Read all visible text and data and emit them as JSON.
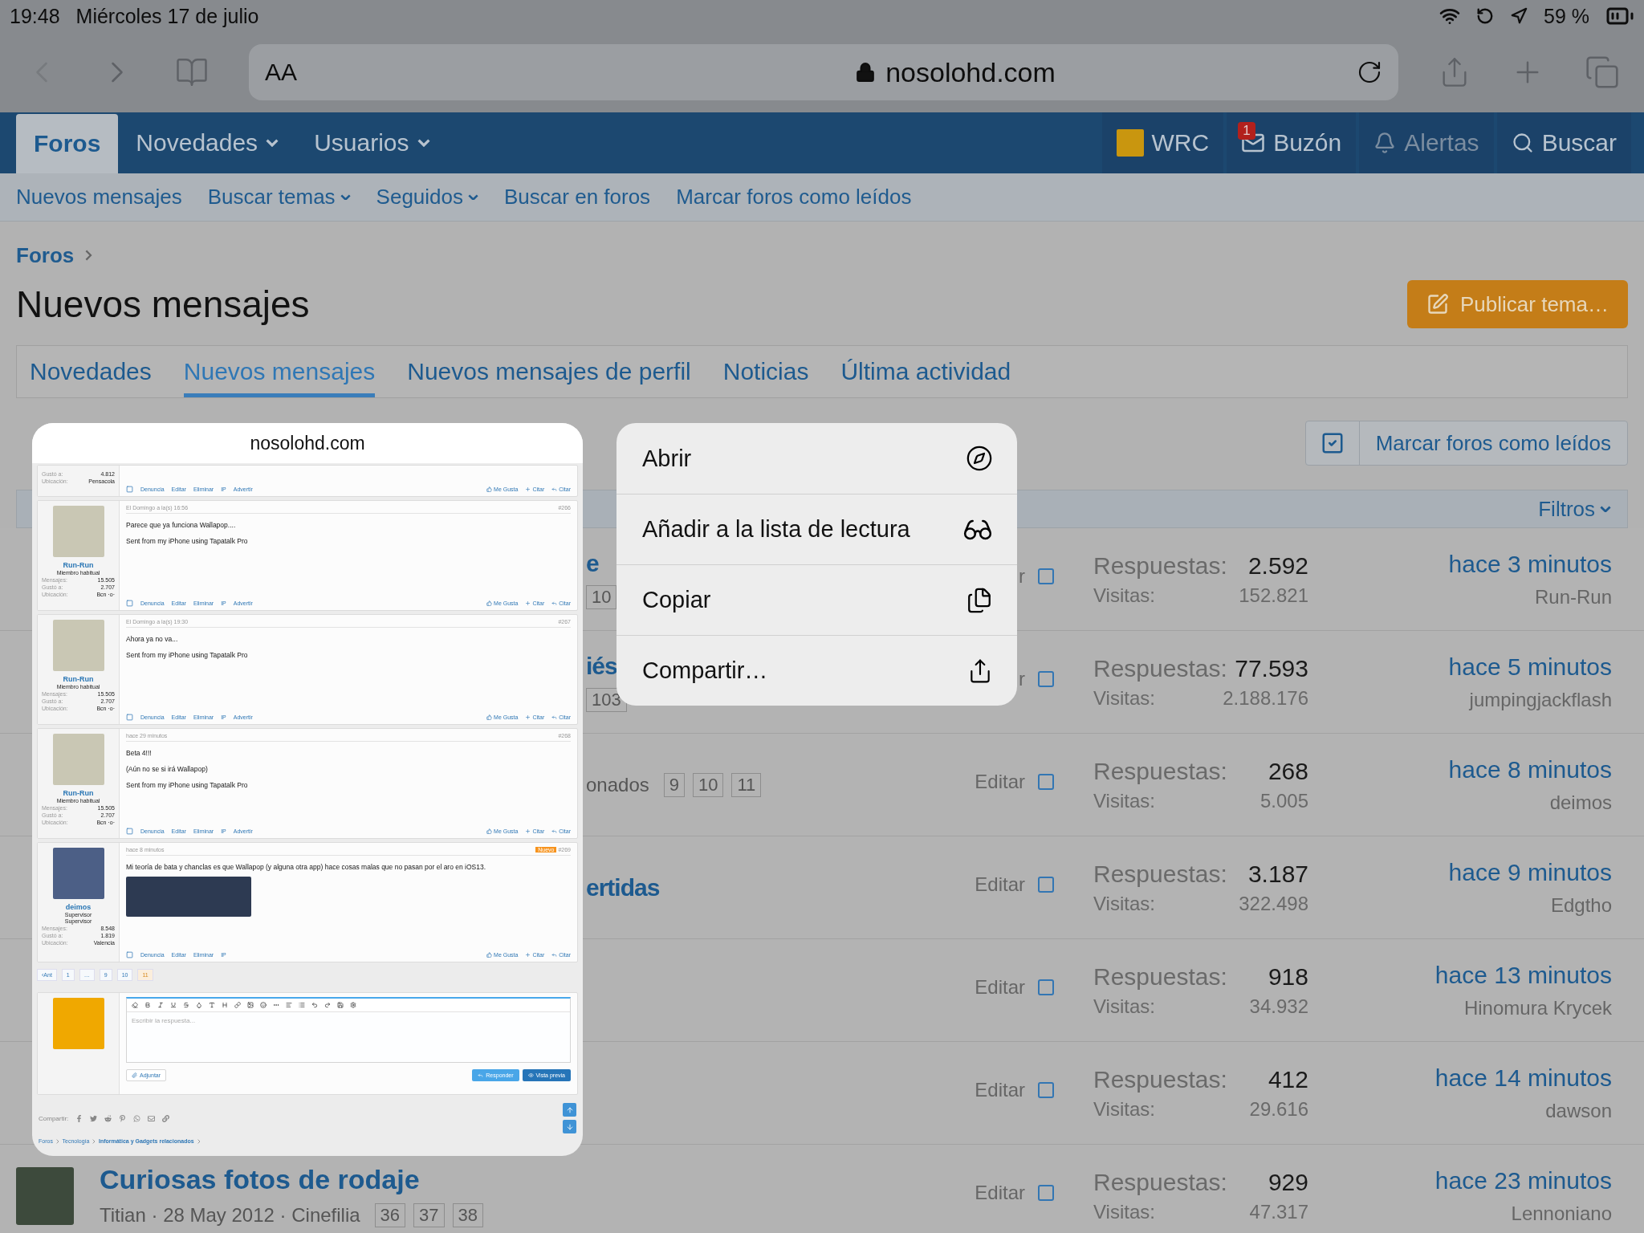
{
  "status_bar": {
    "time": "19:48",
    "date": "Miércoles 17 de julio",
    "battery": "59 %"
  },
  "browser": {
    "text_size": "AA",
    "address": "nosolohd.com"
  },
  "nav": {
    "tabs": [
      {
        "label": "Foros",
        "selected": true,
        "dropdown": false
      },
      {
        "label": "Novedades",
        "selected": false,
        "dropdown": true
      },
      {
        "label": "Usuarios",
        "selected": false,
        "dropdown": true
      }
    ],
    "right": [
      {
        "kind": "avatar",
        "label": "WRC"
      },
      {
        "kind": "mail",
        "label": "Buzón",
        "badge": "1"
      },
      {
        "kind": "bell",
        "label": "Alertas"
      },
      {
        "kind": "search",
        "label": "Buscar"
      }
    ]
  },
  "sub_nav": [
    {
      "label": "Nuevos mensajes",
      "dropdown": false
    },
    {
      "label": "Buscar temas",
      "dropdown": true
    },
    {
      "label": "Seguidos",
      "dropdown": true
    },
    {
      "label": "Buscar en foros",
      "dropdown": false
    },
    {
      "label": "Marcar foros como leídos",
      "dropdown": false
    }
  ],
  "breadcrumb": [
    "Foros"
  ],
  "page_title": "Nuevos mensajes",
  "post_button": "Publicar tema…",
  "tabs": [
    {
      "label": "Novedades",
      "selected": false
    },
    {
      "label": "Nuevos mensajes",
      "selected": true
    },
    {
      "label": "Nuevos mensajes de perfil",
      "selected": false
    },
    {
      "label": "Noticias",
      "selected": false
    },
    {
      "label": "Última actividad",
      "selected": false
    }
  ],
  "mark_read_button": "Marcar foros como leídos",
  "filters": "Filtros",
  "threads": [
    {
      "kind": "partial",
      "title_fragment": "e",
      "pages": [
        "10"
      ],
      "edit": "r",
      "checked": false,
      "replies_label": "Respuestas:",
      "replies": "2.592",
      "views_label": "Visitas:",
      "views": "152.821",
      "time": "hace 3 minutos",
      "user": "Run-Run"
    },
    {
      "kind": "partial",
      "title_fragment": "iés",
      "pages": [
        "103"
      ],
      "edit": "r",
      "checked": false,
      "replies_label": "Respuestas:",
      "replies": "77.593",
      "views_label": "Visitas:",
      "views": "2.188.176",
      "time": "hace 5 minutos",
      "user": "jumpingjackflash"
    },
    {
      "kind": "partial",
      "meta_fragment": "onados",
      "pages": [
        "9",
        "10",
        "11"
      ],
      "edit": "Editar",
      "checked": false,
      "replies_label": "Respuestas:",
      "replies": "268",
      "views_label": "Visitas:",
      "views": "5.005",
      "time": "hace 8 minutos",
      "user": "deimos"
    },
    {
      "kind": "partial",
      "title_fragment": "ertidas",
      "edit": "Editar",
      "checked": false,
      "replies_label": "Respuestas:",
      "replies": "3.187",
      "views_label": "Visitas:",
      "views": "322.498",
      "time": "hace 9 minutos",
      "user": "Edgtho"
    },
    {
      "kind": "partial",
      "edit": "Editar",
      "checked": false,
      "replies_label": "Respuestas:",
      "replies": "918",
      "views_label": "Visitas:",
      "views": "34.932",
      "time": "hace 13 minutos",
      "user": "Hinomura Krycek"
    },
    {
      "kind": "partial",
      "edit": "Editar",
      "checked": false,
      "replies_label": "Respuestas:",
      "replies": "412",
      "views_label": "Visitas:",
      "views": "29.616",
      "time": "hace 14 minutos",
      "user": "dawson"
    },
    {
      "kind": "full",
      "title": "Curiosas fotos de rodaje",
      "meta": "Titian · 28 May 2012 · Cinefilia",
      "pages": [
        "36",
        "37",
        "38"
      ],
      "edit": "Editar",
      "checked": false,
      "replies_label": "Respuestas:",
      "replies": "929",
      "views_label": "Visitas:",
      "views": "47.317",
      "time": "hace 23 minutos",
      "user": "Lennoniano"
    }
  ],
  "preview": {
    "title": "nosolohd.com",
    "top_post": {
      "stats": [
        {
          "label": "Gustó a:",
          "value": "4.812"
        },
        {
          "label": "Ubicación:",
          "value": "Pensacola"
        }
      ],
      "checked": false,
      "actions": [
        "Denuncia",
        "Editar",
        "Eliminar",
        "IP",
        "Advertir"
      ],
      "reactions": [
        "Me Gusta",
        "Citar",
        "Citar"
      ]
    },
    "posts": [
      {
        "user": "Run-Run",
        "roles": [
          "Miembro habitual"
        ],
        "stats": [
          {
            "label": "Mensajes:",
            "value": "15.505"
          },
          {
            "label": "Gustó a:",
            "value": "2.707"
          },
          {
            "label": "Ubicación:",
            "value": "Bcn ·o·"
          }
        ],
        "time": "El Domingo a la(s) 16:56",
        "number": "#266",
        "body": [
          "Parece que ya funciona Wallapop....",
          "Sent from my iPhone using Tapatalk Pro"
        ],
        "has_image": false,
        "checked": false,
        "actions": [
          "Denuncia",
          "Editar",
          "Eliminar",
          "IP",
          "Advertir"
        ],
        "reactions": [
          "Me Gusta",
          "Citar",
          "Citar"
        ]
      },
      {
        "user": "Run-Run",
        "roles": [
          "Miembro habitual"
        ],
        "stats": [
          {
            "label": "Mensajes:",
            "value": "15.505"
          },
          {
            "label": "Gustó a:",
            "value": "2.707"
          },
          {
            "label": "Ubicación:",
            "value": "Bcn ·o·"
          }
        ],
        "time": "El Domingo a la(s) 19:30",
        "number": "#267",
        "body": [
          "Ahora ya no va...",
          "Sent from my iPhone using Tapatalk Pro"
        ],
        "has_image": false,
        "checked": false,
        "actions": [
          "Denuncia",
          "Editar",
          "Eliminar",
          "IP",
          "Advertir"
        ],
        "reactions": [
          "Me Gusta",
          "Citar",
          "Citar"
        ]
      },
      {
        "user": "Run-Run",
        "roles": [
          "Miembro habitual"
        ],
        "stats": [
          {
            "label": "Mensajes:",
            "value": "15.505"
          },
          {
            "label": "Gustó a:",
            "value": "2.707"
          },
          {
            "label": "Ubicación:",
            "value": "Bcn ·o·"
          }
        ],
        "time": "hace 29 minutos",
        "number": "#268",
        "body": [
          "Beta 4!!!",
          "(Aún no se si irá Wallapop)",
          "Sent from my iPhone using Tapatalk Pro"
        ],
        "has_image": false,
        "checked": false,
        "actions": [
          "Denuncia",
          "Editar",
          "Eliminar",
          "IP",
          "Advertir"
        ],
        "reactions": [
          "Me Gusta",
          "Citar",
          "Citar"
        ]
      },
      {
        "user": "deimos",
        "roles": [
          "Supervisor",
          "Supervisor"
        ],
        "stats": [
          {
            "label": "Mensajes:",
            "value": "8.548"
          },
          {
            "label": "Gustó a:",
            "value": "1.819"
          },
          {
            "label": "Ubicación:",
            "value": "Valencia"
          }
        ],
        "time": "hace 8 minutos",
        "badge": "Nuevo",
        "number": "#269",
        "body": [
          "Mi teoría de bata y chanclas es que Wallapop (y alguna otra app) hace cosas malas que no pasan por el aro en iOS13."
        ],
        "has_image": true,
        "checked": false,
        "actions": [
          "Denuncia",
          "Editar",
          "Eliminar",
          "IP"
        ],
        "reactions": [
          "Me Gusta",
          "Citar",
          "Citar"
        ]
      }
    ],
    "pagination": [
      {
        "label": "‹Ant",
        "selected": false
      },
      {
        "label": "1",
        "selected": false
      },
      {
        "label": "…",
        "selected": false
      },
      {
        "label": "9",
        "selected": false
      },
      {
        "label": "10",
        "selected": false
      },
      {
        "label": "11",
        "selected": true
      }
    ],
    "editor": {
      "placeholder": "Escribir la respuesta...",
      "attach": "Adjuntar",
      "reply": "Responder",
      "preview": "Vista previa"
    },
    "share_label": "Compartir:",
    "breadcrumb": [
      {
        "label": "Foros",
        "bold": false
      },
      {
        "label": "Tecnología",
        "bold": false
      },
      {
        "label": "Informática y Gadgets relacionados",
        "bold": true
      }
    ]
  },
  "context_menu": [
    {
      "kind": "compass",
      "label": "Abrir"
    },
    {
      "kind": "glasses",
      "label": "Añadir a la lista de lectura"
    },
    {
      "kind": "copy",
      "label": "Copiar"
    },
    {
      "kind": "share",
      "label": "Compartir…"
    }
  ]
}
